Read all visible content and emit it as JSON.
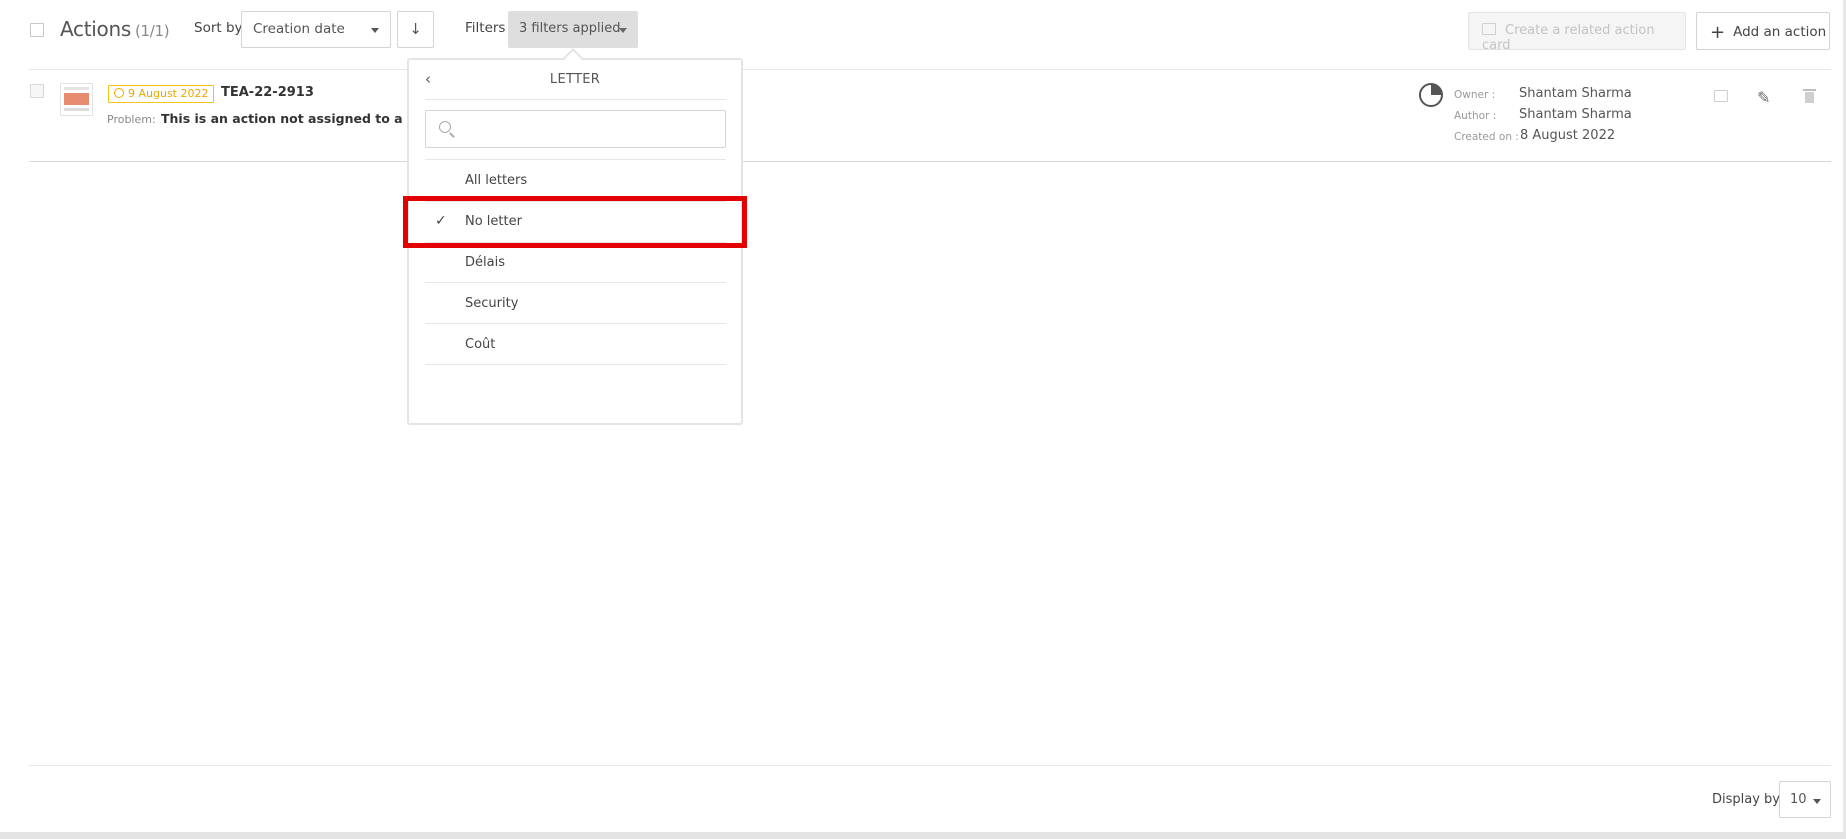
{
  "header": {
    "title": "Actions",
    "count": "(1/1)",
    "sort_label": "Sort by",
    "sort_value": "Creation date",
    "sort_direction_icon": "arrow-down-icon",
    "filters_label": "Filters",
    "filters_value": "3 filters applied",
    "related_button": "Create a related action card",
    "add_button": "Add an action"
  },
  "row": {
    "date": "9 August 2022",
    "ref": "TEA-22-2913",
    "problem_label": "Problem:",
    "problem_text": "This is an action not assigned to a letter",
    "progress_icon": "pie-progress-icon",
    "owner_label": "Owner :",
    "owner": "Shantam Sharma",
    "author_label": "Author :",
    "author": "Shantam Sharma",
    "created_label": "Created on :",
    "created": "8 August 2022"
  },
  "dropdown": {
    "back_icon": "chevron-left-icon",
    "title": "LETTER",
    "search_placeholder": "",
    "options": [
      {
        "label": "All letters",
        "selected": false
      },
      {
        "label": "No letter",
        "selected": true
      },
      {
        "label": "Délais",
        "selected": false
      },
      {
        "label": "Security",
        "selected": false
      },
      {
        "label": "Coût",
        "selected": false
      }
    ],
    "check_glyph": "✓"
  },
  "footer": {
    "display_label": "Display by",
    "display_value": "10"
  },
  "colors": {
    "highlight": "#e30000",
    "date_badge": "#f0c419",
    "thumbnail_accent": "#e78c70"
  }
}
